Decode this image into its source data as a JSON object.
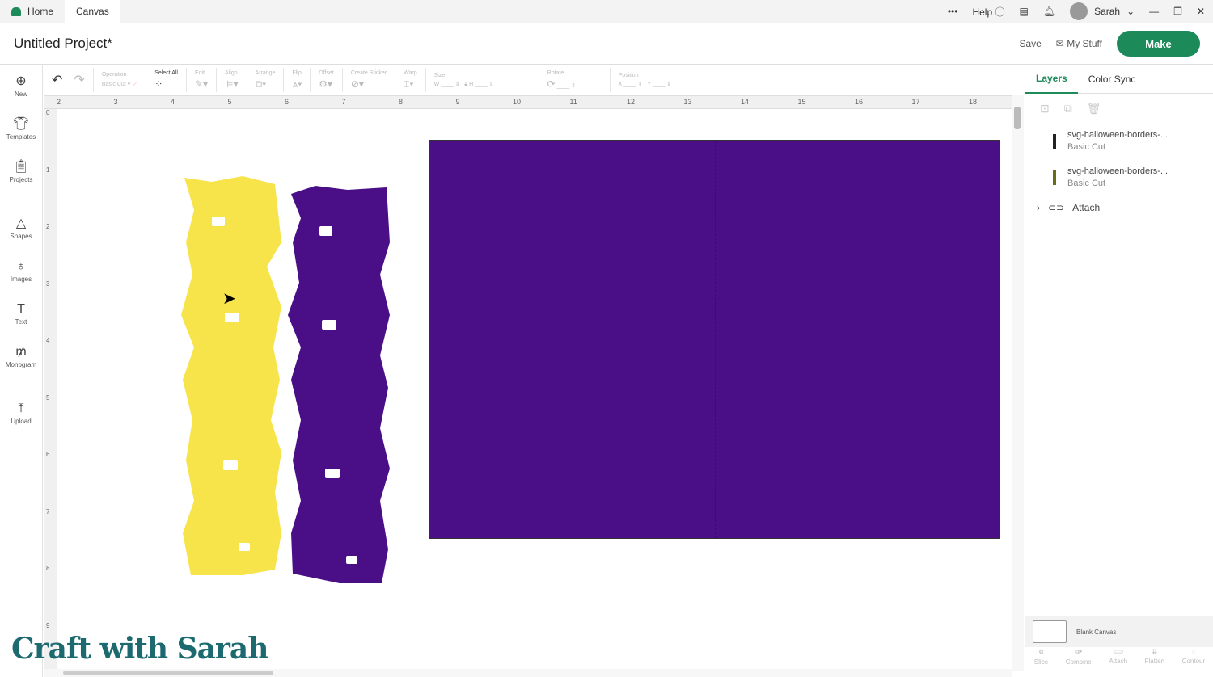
{
  "topbar": {
    "tabs": [
      "Home",
      "Canvas"
    ],
    "more": "•••",
    "help": "Help",
    "user": "Sarah"
  },
  "header": {
    "title": "Untitled Project*",
    "save": "Save",
    "my_stuff": "My Stuff",
    "make": "Make"
  },
  "leftbar": [
    "New",
    "Templates",
    "Projects",
    "Shapes",
    "Images",
    "Text",
    "Monogram",
    "Upload"
  ],
  "toolbar": {
    "operation": "Operation",
    "operation_value": "Basic Cut",
    "select_all": "Select All",
    "edit": "Edit",
    "align": "Align",
    "arrange": "Arrange",
    "flip": "Flip",
    "offset": "Offset",
    "create_sticker": "Create Sticker",
    "warp": "Warp",
    "size": "Size",
    "w": "W",
    "h": "H",
    "rotate": "Rotate",
    "position": "Position",
    "x": "X",
    "y": "Y"
  },
  "ruler_h": [
    "2",
    "3",
    "4",
    "5",
    "6",
    "7",
    "8",
    "9",
    "10",
    "11",
    "12",
    "13",
    "14",
    "15",
    "16",
    "17",
    "18"
  ],
  "ruler_v": [
    "0",
    "1",
    "2",
    "3",
    "4",
    "5",
    "6",
    "7",
    "8",
    "9"
  ],
  "panel": {
    "tabs": [
      "Layers",
      "Color Sync"
    ],
    "layers": [
      {
        "name": "svg-halloween-borders-...",
        "op": "Basic Cut"
      },
      {
        "name": "svg-halloween-borders-...",
        "op": "Basic Cut"
      }
    ],
    "attach": "Attach",
    "blank_canvas": "Blank Canvas",
    "actions": [
      "Slice",
      "Combine",
      "Attach",
      "Flatten",
      "Contour"
    ]
  },
  "watermark": "Craft with Sarah",
  "colors": {
    "accent": "#1d8a5a",
    "mat": "#4a0f87",
    "yellow": "#f7e34a",
    "purple": "#4a0f87"
  }
}
